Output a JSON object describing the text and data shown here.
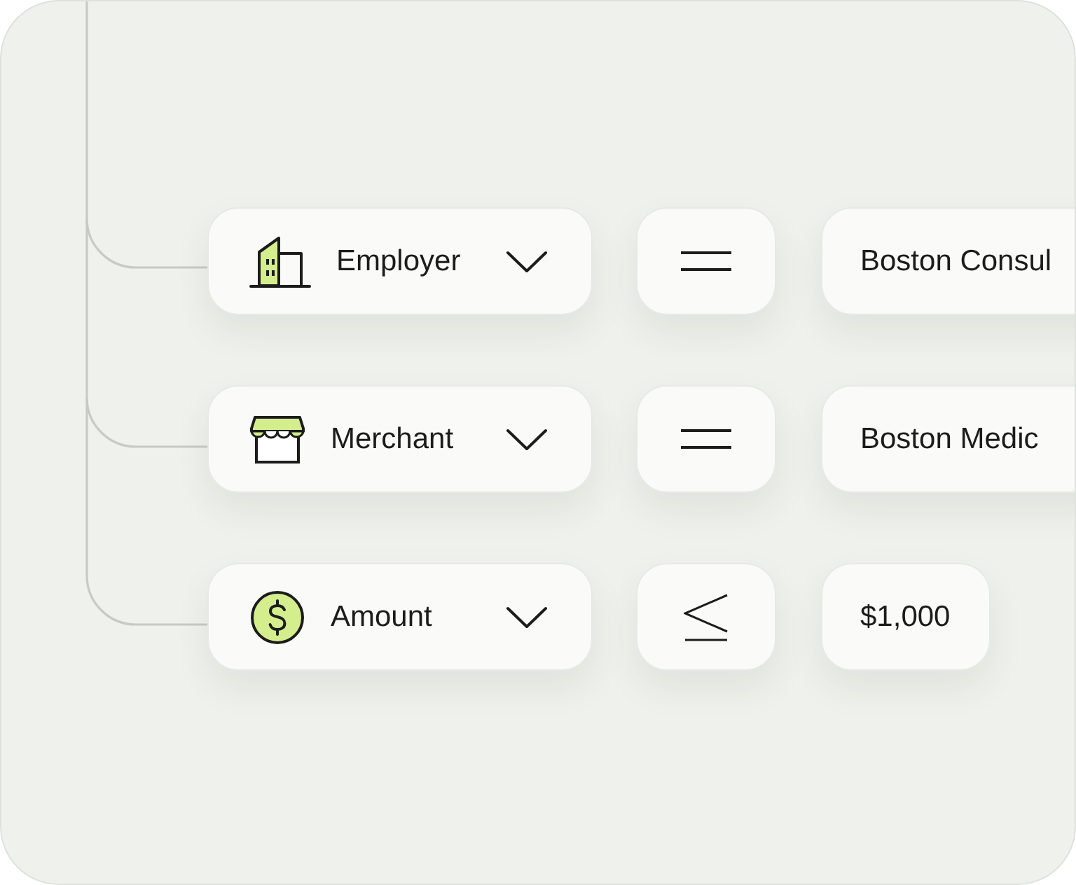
{
  "rows": [
    {
      "field": {
        "label": "Employer"
      },
      "operator": {
        "kind": "equals"
      },
      "value": "Boston Consul"
    },
    {
      "field": {
        "label": "Merchant"
      },
      "operator": {
        "kind": "equals"
      },
      "value": "Boston Medic"
    },
    {
      "field": {
        "label": "Amount"
      },
      "operator": {
        "kind": "less_or_equal"
      },
      "value": "$1,000"
    }
  ]
}
